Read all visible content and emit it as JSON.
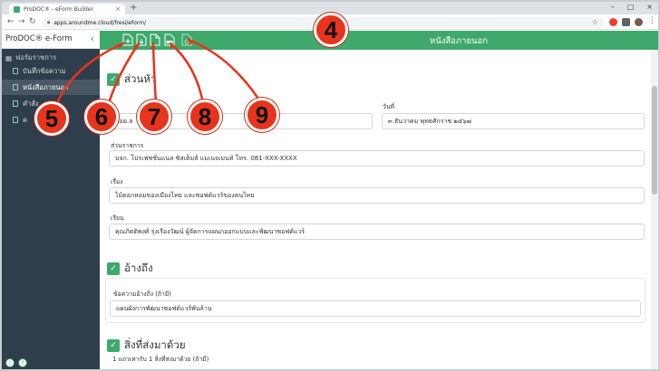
{
  "browser": {
    "tab_title": "ProDOC® - eForm Builder",
    "tab_close": "×",
    "new_tab": "+",
    "url": "apps.aroundme.cloud/fresi/eform/",
    "window_controls": [
      "–",
      "□",
      "×"
    ]
  },
  "sidebar": {
    "title": "ProDOC® e-Form",
    "collapse_icon": "‹",
    "section": "ฟอร์มราชการ",
    "items": [
      {
        "label": "บันทึกข้อความ"
      },
      {
        "label": "หนังสือภายนอก"
      },
      {
        "label": "คำสั่ง"
      },
      {
        "label": "ค"
      }
    ],
    "footer": [
      "i",
      "?"
    ]
  },
  "toolbar": {
    "document_title": "หนังสือภายนอก",
    "icons": [
      "new-document-icon",
      "download-document-icon",
      "blank-document-icon",
      "export-jpg-icon",
      "pdf-document-icon"
    ]
  },
  "form": {
    "section_header": {
      "title": "ส่วนหัว",
      "field1_value": "พอย.ล",
      "date_label": "วันที่",
      "date_value": "๓ ธันวาคม พุทธศักราช ๒๕๖๗",
      "agency_label": "ส่วนราชการ",
      "agency_value": "บจก. โปรเฟชชั่นแนล ซิสเต็มส์ แมเนจเมนท์ โทร. 081-XXX-XXXX",
      "subject_label": "เรื่อง",
      "subject_value": "ไม้ดอกหอมของเมืองไทย และซอฟต์แวร์ของคนไทย",
      "to_label": "เรียน",
      "to_value": "คุณภิตติพงศ์ รุ่งเรืองวัฒน์ ผู้จัดการแผนกออกแบบและพัฒนาซอฟต์แวร์"
    },
    "section_reference": {
      "title": "อ้างถึง",
      "label": "ข้อความอ้างถึง (ถ้ามี)",
      "value": "แผนผังการพัฒนาซอฟต์แวร์พันล้าน"
    },
    "section_attachments": {
      "title": "สิ่งที่ส่งมาด้วย",
      "note": "1 แถวเท่ากับ 1 สิ่งที่ส่งมาด้วย (ถ้ามี)"
    }
  },
  "callouts": [
    "4",
    "5",
    "6",
    "7",
    "8",
    "9"
  ],
  "colors": {
    "accent_green": "#3ea96b",
    "sidebar_bg": "#2f3e4c",
    "callout_red": "#e8341c"
  }
}
